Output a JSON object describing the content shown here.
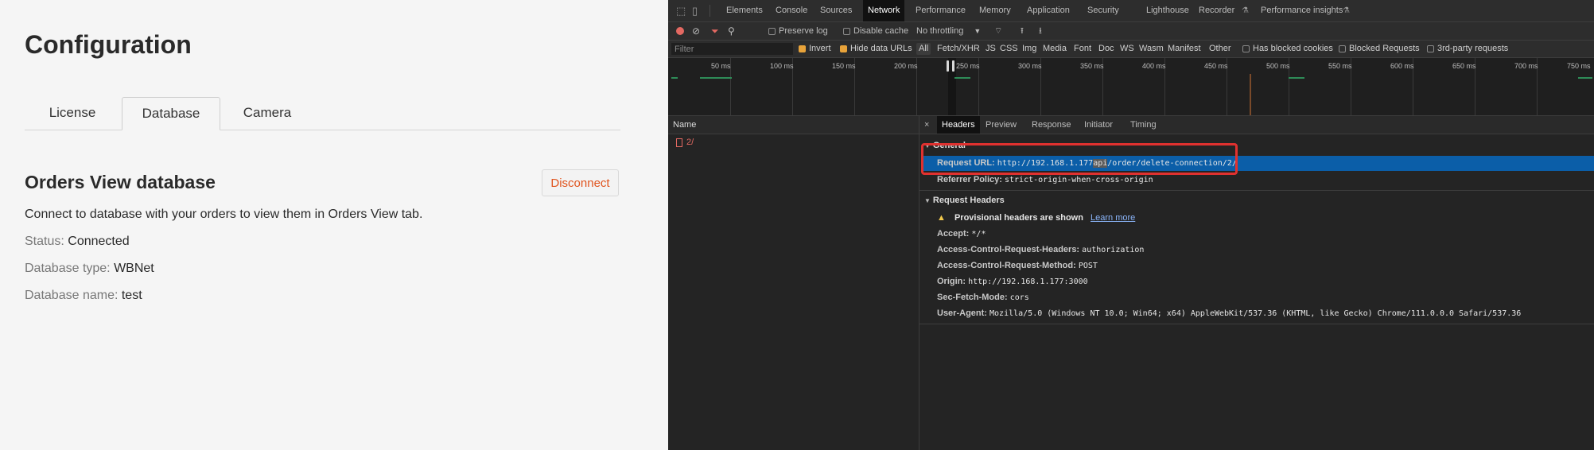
{
  "app": {
    "title": "Configuration",
    "tabs": [
      {
        "label": "License"
      },
      {
        "label": "Database"
      },
      {
        "label": "Camera"
      }
    ],
    "section_title": "Orders View database",
    "disconnect_label": "Disconnect",
    "description": "Connect to database with your orders to view them in Orders View tab.",
    "fields": [
      {
        "key": "Status:",
        "value": "Connected"
      },
      {
        "key": "Database type:",
        "value": "WBNet"
      },
      {
        "key": "Database name:",
        "value": "test"
      }
    ]
  },
  "devtools": {
    "tabs": [
      "Elements",
      "Console",
      "Sources",
      "Network",
      "Performance",
      "Memory",
      "Application",
      "Security",
      "Lighthouse",
      "Recorder",
      "Performance insights"
    ],
    "active_tab": "Network",
    "toolbar": {
      "preserve_log": "Preserve log",
      "disable_cache": "Disable cache",
      "throttling": "No throttling"
    },
    "filter": {
      "placeholder": "Filter",
      "invert": "Invert",
      "hide_data_urls": "Hide data URLs",
      "types": [
        "All",
        "Fetch/XHR",
        "JS",
        "CSS",
        "Img",
        "Media",
        "Font",
        "Doc",
        "WS",
        "Wasm",
        "Manifest",
        "Other"
      ],
      "blocked_cookies": "Has blocked cookies",
      "blocked_requests": "Blocked Requests",
      "third_party": "3rd-party requests"
    },
    "timeline_ticks": [
      "50 ms",
      "100 ms",
      "150 ms",
      "200 ms",
      "250 ms",
      "300 ms",
      "350 ms",
      "400 ms",
      "450 ms",
      "500 ms",
      "550 ms",
      "600 ms",
      "650 ms",
      "700 ms",
      "750 ms"
    ],
    "name_header": "Name",
    "request_name": "2/",
    "detail_tabs": [
      "Headers",
      "Preview",
      "Response",
      "Initiator",
      "Timing"
    ],
    "close_label": "×",
    "general": {
      "title": "General",
      "request_url_key": "Request URL:",
      "request_url_value_a": "http://192.168.1.177",
      "request_url_value_b": "api",
      "request_url_value_c": "/order/delete-connection/2/",
      "referrer_key": "Referrer Policy:",
      "referrer_value": "strict-origin-when-cross-origin"
    },
    "request_headers": {
      "title": "Request Headers",
      "warning": "Provisional headers are shown",
      "learn_more": "Learn more",
      "items": [
        {
          "key": "Accept:",
          "value": "*/*"
        },
        {
          "key": "Access-Control-Request-Headers:",
          "value": "authorization"
        },
        {
          "key": "Access-Control-Request-Method:",
          "value": "POST"
        },
        {
          "key": "Origin:",
          "value": "http://192.168.1.177:3000"
        },
        {
          "key": "Sec-Fetch-Mode:",
          "value": "cors"
        },
        {
          "key": "User-Agent:",
          "value": "Mozilla/5.0 (Windows NT 10.0; Win64; x64) AppleWebKit/537.36 (KHTML, like Gecko) Chrome/111.0.0.0 Safari/537.36"
        }
      ]
    },
    "colors": {
      "accent_blue": "#0b5ea8",
      "error_red": "#e46962",
      "highlight_box": "#e0312f",
      "disconnect_orange": "#e0541e"
    }
  }
}
